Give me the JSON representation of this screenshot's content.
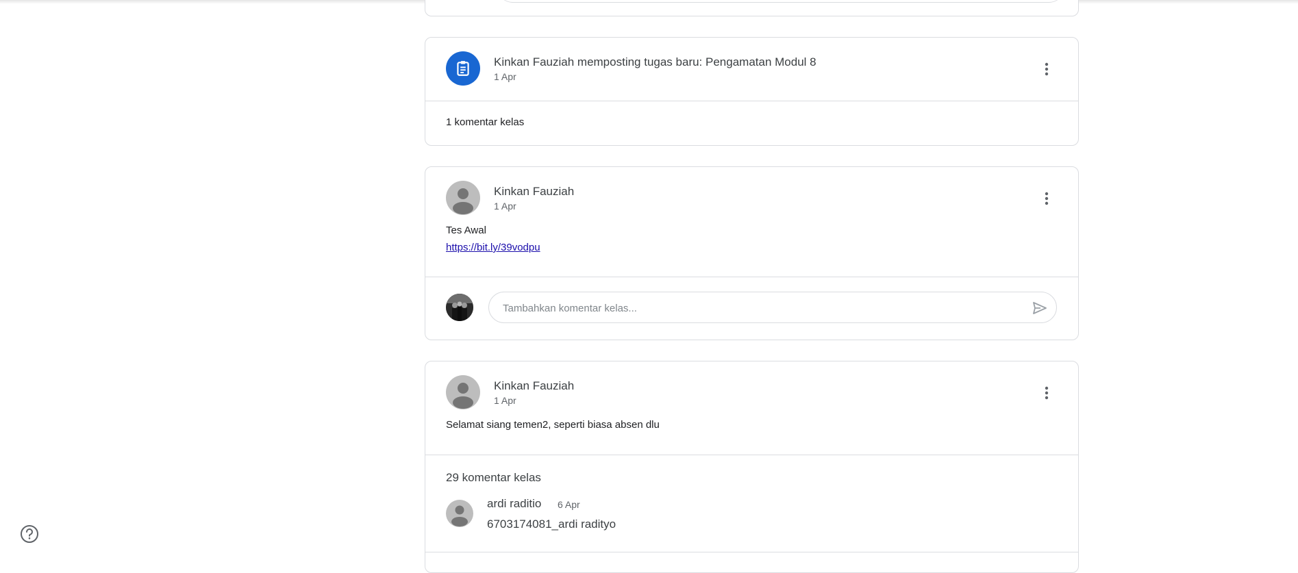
{
  "posts": [
    {
      "poster": "Kinkan Fauziah memposting tugas baru: Pengamatan Modul 8",
      "date": "1 Apr",
      "comment_count": "1 komentar kelas"
    },
    {
      "poster": "Kinkan Fauziah",
      "date": "1 Apr",
      "body": "Tes Awal",
      "link": "https://bit.ly/39vodpu",
      "comment_placeholder": "Tambahkan komentar kelas..."
    },
    {
      "poster": "Kinkan Fauziah",
      "date": "1 Apr",
      "body": "Selamat siang temen2, seperti biasa absen dlu",
      "comment_count": "29 komentar kelas",
      "comments": [
        {
          "author": "ardi raditio",
          "date": "6 Apr",
          "text": "6703174081_ardi radityo"
        }
      ]
    }
  ],
  "icons": {
    "assignment": "assignment-icon",
    "more": "more-vert-icon",
    "send": "send-icon",
    "help": "help-icon",
    "avatar": "person-icon"
  },
  "colors": {
    "accent": "#1967d2",
    "link": "#1a0dab",
    "border": "#dadce0"
  }
}
